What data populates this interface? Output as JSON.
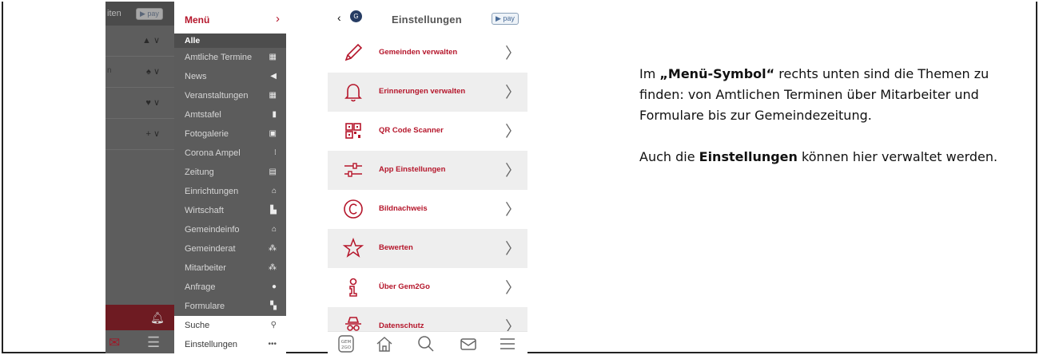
{
  "left_screen": {
    "cut_label": "iten",
    "pay_badge": "pay",
    "row_fragment": "n"
  },
  "menu": {
    "title": "Menü",
    "section": "Alle",
    "items": [
      {
        "label": "Amtliche Termine",
        "icon": "calendar-icon"
      },
      {
        "label": "News",
        "icon": "megaphone-icon"
      },
      {
        "label": "Veranstaltungen",
        "icon": "calendar-grid-icon"
      },
      {
        "label": "Amtstafel",
        "icon": "clipboard-icon"
      },
      {
        "label": "Fotogalerie",
        "icon": "images-icon"
      },
      {
        "label": "Corona Ampel",
        "icon": "traffic-light-icon"
      },
      {
        "label": "Zeitung",
        "icon": "newspaper-icon"
      },
      {
        "label": "Einrichtungen",
        "icon": "building-icon"
      },
      {
        "label": "Wirtschaft",
        "icon": "industry-icon"
      },
      {
        "label": "Gemeindeinfo",
        "icon": "building-icon"
      },
      {
        "label": "Gemeinderat",
        "icon": "users-icon"
      },
      {
        "label": "Mitarbeiter",
        "icon": "users-icon"
      },
      {
        "label": "Anfrage",
        "icon": "comments-icon"
      },
      {
        "label": "Formulare",
        "icon": "scroll-icon"
      },
      {
        "label": "Suche",
        "icon": "search-icon"
      },
      {
        "label": "Einstellungen",
        "icon": "more-icon"
      }
    ]
  },
  "settings": {
    "title": "Einstellungen",
    "pay_badge": "pay",
    "avatar": "G",
    "items": [
      {
        "label": "Gemeinden verwalten",
        "icon": "pencil-icon"
      },
      {
        "label": "Erinnerungen verwalten",
        "icon": "bell-icon"
      },
      {
        "label": "QR Code Scanner",
        "icon": "qr-code-icon"
      },
      {
        "label": "App Einstellungen",
        "icon": "sliders-icon"
      },
      {
        "label": "Bildnachweis",
        "icon": "copyright-icon"
      },
      {
        "label": "Bewerten",
        "icon": "star-icon"
      },
      {
        "label": "Über Gem2Go",
        "icon": "info-icon"
      },
      {
        "label": "Datenschutz",
        "icon": "spy-icon"
      }
    ],
    "tabbar": {
      "logo_top": "GEM",
      "logo_bottom": "2GO"
    }
  },
  "description": {
    "p1_pre": "Im ",
    "p1_bold": "„Menü-Symbol“",
    "p1_post": " rechts unten sind die Themen zu finden: von Amtlichen Terminen über Mitarbeiter und Formulare bis zur Gemeindezeitung.",
    "p2_pre": "Auch die ",
    "p2_bold": "Einstellungen",
    "p2_post": " können hier verwaltet werden."
  }
}
